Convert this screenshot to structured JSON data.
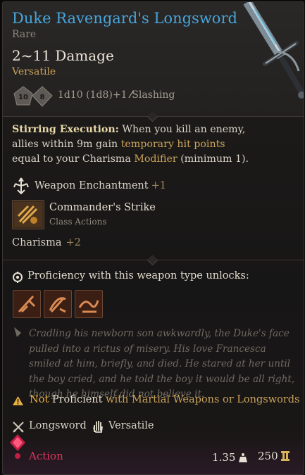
{
  "item": {
    "name": "Duke Ravengard's Longsword",
    "rarity": "Rare",
    "damage": "2~11 Damage",
    "property": "Versatile",
    "dice_labels": [
      "10",
      "8"
    ],
    "damage_formula": "1d10 (1d8)+1",
    "damage_type": "Slashing"
  },
  "passive": {
    "name": "Stirring Execution:",
    "text_1": " When you kill an enemy, allies within 9m gain ",
    "link_1": "temporary hit points",
    "text_2": " equal to your Charisma ",
    "link_2": "Modifier",
    "text_3": " (minimum 1)."
  },
  "enchantment": {
    "label": "Weapon Enchantment",
    "value": "+1"
  },
  "action": {
    "name": "Commander's Strike",
    "category": "Class Actions"
  },
  "ability_bonus": {
    "label": "Charisma",
    "value": "+2"
  },
  "proficiency": {
    "title": "Proficiency with this weapon type unlocks:"
  },
  "flavor": "Cradling his newborn son awkwardly, the Duke's face pulled into a rictus of misery. His love Francesca smiled at him, briefly, and died. He stared at her until the boy cried, and he told the boy it would be all right, though he himself did not believe it.",
  "warning": {
    "not": "Not",
    "proficient": "Proficient",
    "rest": "with Martial Weapons or Longswords"
  },
  "tags": {
    "type": "Longsword",
    "property": "Versatile"
  },
  "footer": {
    "action_type": "Action",
    "weight": "1.35",
    "price": "250"
  },
  "colors": {
    "title": "#46a6dc",
    "gold": "#c9a25a",
    "warning": "#e8b040",
    "action": "#e0355f"
  }
}
